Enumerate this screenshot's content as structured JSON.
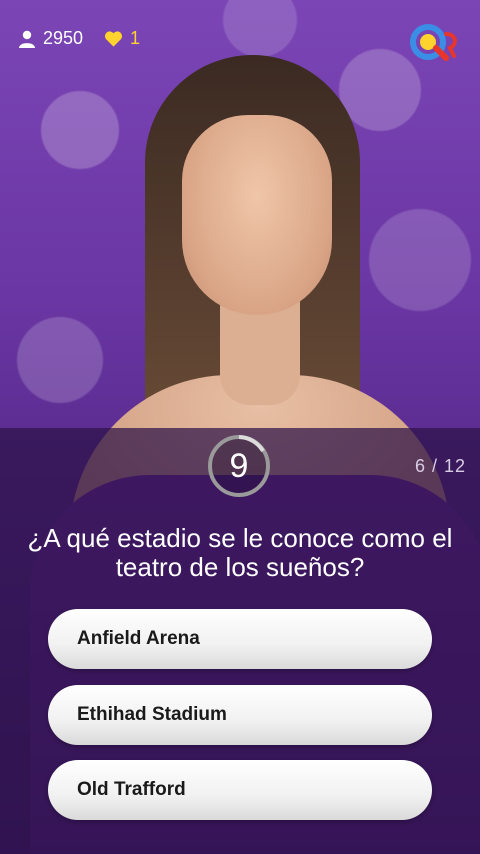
{
  "header": {
    "players_count": "2950",
    "lives_count": "1",
    "players_icon": "user-icon",
    "lives_icon": "heart-icon",
    "logo_icon": "q-logo-icon"
  },
  "quiz": {
    "timer_value": "9",
    "progress": "6 / 12",
    "question": "¿A qué estadio se le conoce como el teatro de los sueños?",
    "answers": [
      {
        "label": "Anfield Arena"
      },
      {
        "label": "Ethihad Stadium"
      },
      {
        "label": "Old Trafford"
      }
    ]
  },
  "colors": {
    "background_purple": "#6a36a3",
    "heart_yellow": "#ffd22e",
    "answer_button": "#f1f1f1",
    "logo_blue": "#3a8ee6",
    "logo_yellow": "#ffd22e",
    "logo_red": "#e8362b"
  }
}
